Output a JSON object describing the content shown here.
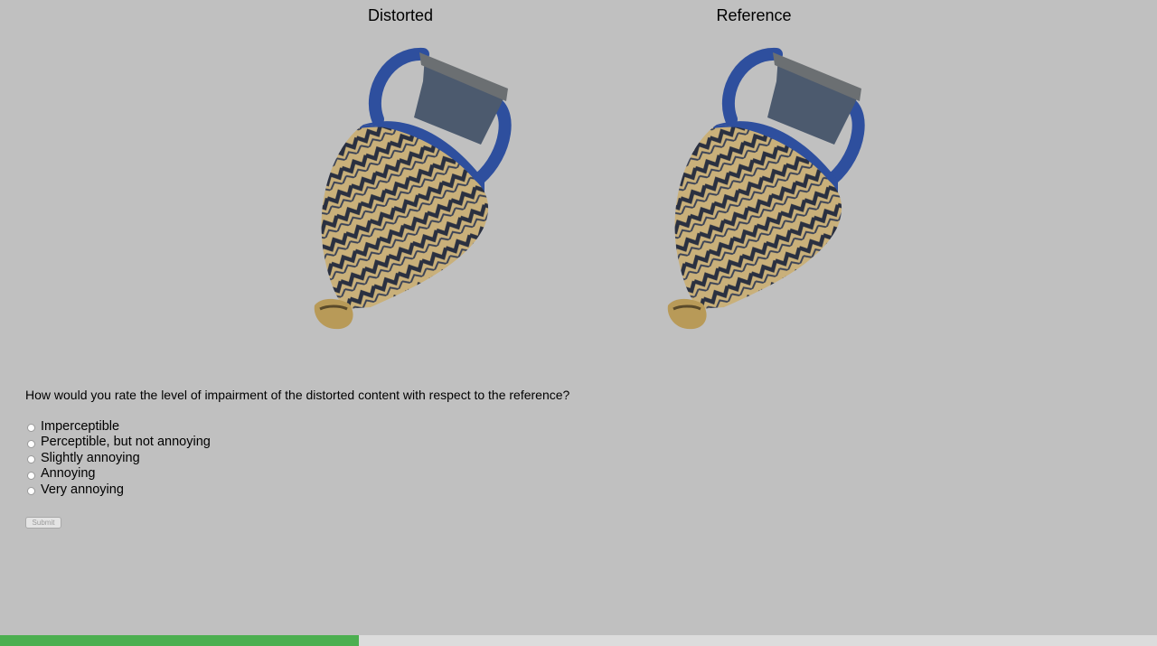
{
  "panels": {
    "distorted": {
      "title": "Distorted"
    },
    "reference": {
      "title": "Reference"
    }
  },
  "question": "How would you rate the level of impairment of the distorted content with respect to the reference?",
  "options": [
    {
      "label": "Imperceptible"
    },
    {
      "label": "Perceptible, but not annoying"
    },
    {
      "label": "Slightly annoying"
    },
    {
      "label": "Annoying"
    },
    {
      "label": "Very annoying"
    }
  ],
  "submit_label": "Submit",
  "progress_fraction": 0.31,
  "colors": {
    "background": "#c0c0c0",
    "progress_fill": "#4caf50",
    "progress_track": "#dcdcdc",
    "vase_blue": "#2e4f9e",
    "vase_tan": "#c9b07a",
    "vase_zigzag": "#2a3040"
  }
}
